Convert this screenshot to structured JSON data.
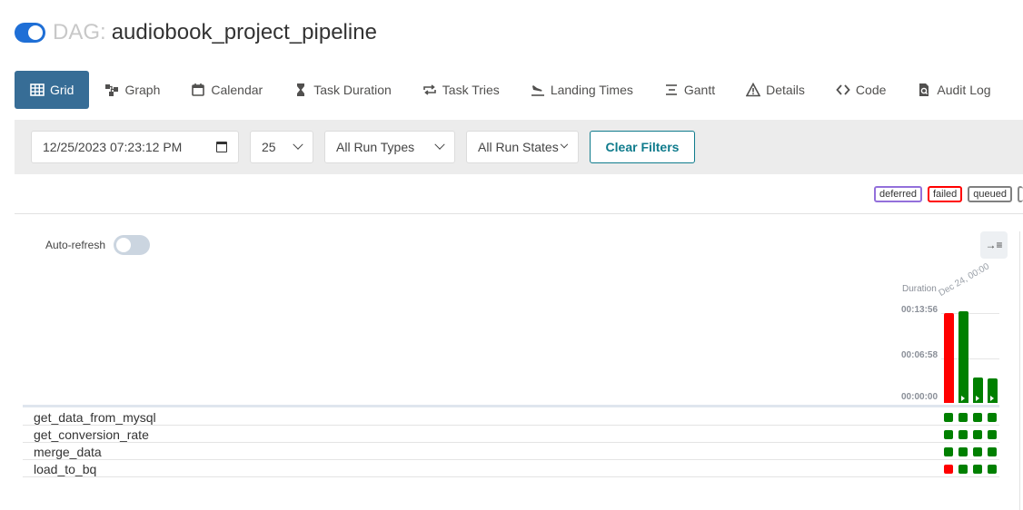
{
  "header": {
    "prefix": "DAG:",
    "dag_id": "audiobook_project_pipeline"
  },
  "nav": [
    {
      "label": "Grid",
      "icon": "grid-icon",
      "active": true
    },
    {
      "label": "Graph",
      "icon": "graph-icon"
    },
    {
      "label": "Calendar",
      "icon": "calendar-icon"
    },
    {
      "label": "Task Duration",
      "icon": "hourglass-icon"
    },
    {
      "label": "Task Tries",
      "icon": "retry-icon"
    },
    {
      "label": "Landing Times",
      "icon": "plane-landing-icon"
    },
    {
      "label": "Gantt",
      "icon": "gantt-icon"
    },
    {
      "label": "Details",
      "icon": "warning-triangle-icon"
    },
    {
      "label": "Code",
      "icon": "code-icon"
    },
    {
      "label": "Audit Log",
      "icon": "audit-file-icon"
    }
  ],
  "filters": {
    "date": "12/25/2023 07:23:12 PM",
    "num_runs": "25",
    "run_type": "All Run Types",
    "run_state": "All Run States",
    "clear_label": "Clear Filters"
  },
  "legend": [
    {
      "label": "deferred",
      "color": "#9370db"
    },
    {
      "label": "failed",
      "color": "#ff0000"
    },
    {
      "label": "queued",
      "color": "#808080"
    }
  ],
  "grid": {
    "auto_refresh_label": "Auto-refresh",
    "duration_label": "Duration",
    "run_date_label": "Dec 24, 00:00",
    "ticks": [
      "00:13:56",
      "00:06:58",
      "00:00:00"
    ],
    "runs": [
      {
        "state": "failed",
        "duration_fraction": 0.98
      },
      {
        "state": "success",
        "duration_fraction": 1.0
      },
      {
        "state": "success",
        "duration_fraction": 0.28
      },
      {
        "state": "success",
        "duration_fraction": 0.27
      }
    ],
    "tasks": [
      {
        "name": "get_data_from_mysql",
        "states": [
          "success",
          "success",
          "success",
          "success"
        ]
      },
      {
        "name": "get_conversion_rate",
        "states": [
          "success",
          "success",
          "success",
          "success"
        ]
      },
      {
        "name": "merge_data",
        "states": [
          "success",
          "success",
          "success",
          "success"
        ]
      },
      {
        "name": "load_to_bq",
        "states": [
          "failed",
          "success",
          "success",
          "success"
        ]
      }
    ],
    "state_colors": {
      "success": "#008000",
      "failed": "#ff0000"
    }
  }
}
